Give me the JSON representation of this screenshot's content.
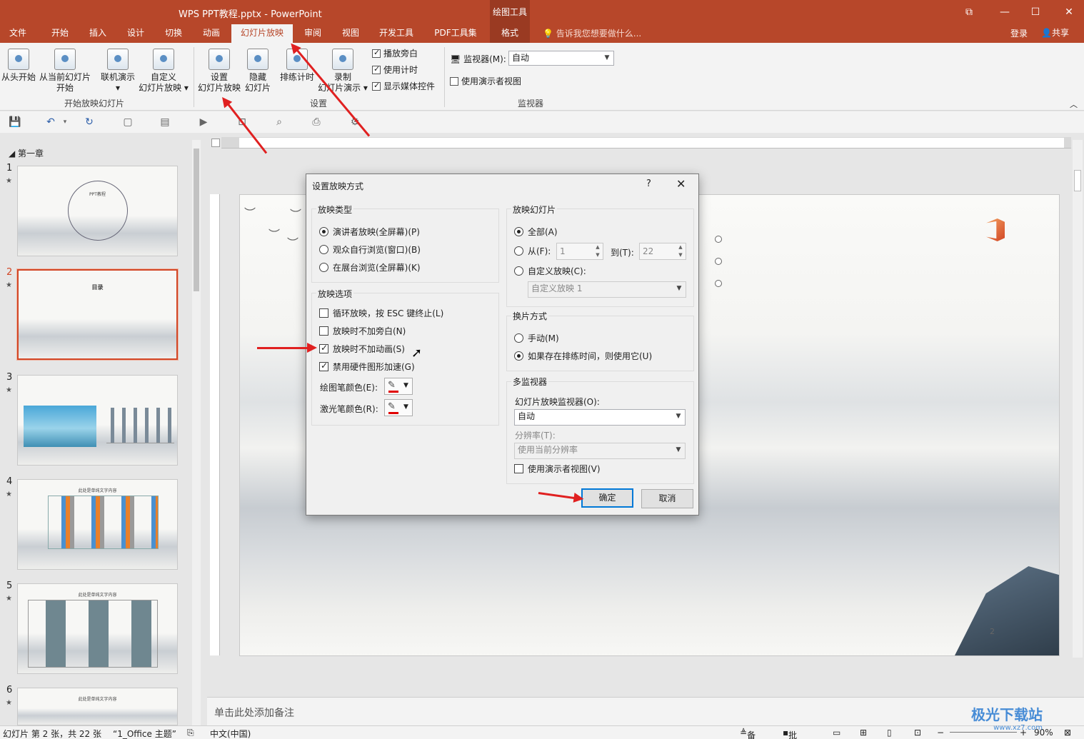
{
  "titlebar": {
    "title": "WPS PPT教程.pptx - PowerPoint",
    "context_label": "绘图工具",
    "minimize": "—",
    "maximize": "☐",
    "close": "✕",
    "restore": "⧉"
  },
  "tabs": {
    "items": [
      {
        "label": "文件"
      },
      {
        "label": "开始"
      },
      {
        "label": "插入"
      },
      {
        "label": "设计"
      },
      {
        "label": "切换"
      },
      {
        "label": "动画"
      },
      {
        "label": "幻灯片放映",
        "active": true
      },
      {
        "label": "审阅"
      },
      {
        "label": "视图"
      },
      {
        "label": "开发工具"
      },
      {
        "label": "PDF工具集"
      },
      {
        "label": "格式"
      }
    ],
    "tell_me": "告诉我您想要做什么...",
    "login": "登录",
    "share": "共享"
  },
  "ribbon": {
    "start_group": {
      "label": "开始放映幻灯片",
      "from_start": "从头开始",
      "from_current_1": "从当前幻灯片",
      "from_current_2": "开始",
      "online_1": "联机演示",
      "online_2": "▾",
      "custom_1": "自定义",
      "custom_2": "幻灯片放映 ▾"
    },
    "setup_group": {
      "label": "设置",
      "setup_1": "设置",
      "setup_2": "幻灯片放映",
      "hide_1": "隐藏",
      "hide_2": "幻灯片",
      "rehearse": "排练计时",
      "record_1": "录制",
      "record_2": "幻灯片演示 ▾",
      "narration": "播放旁白",
      "use_timings": "使用计时",
      "show_media": "显示媒体控件"
    },
    "monitor_group": {
      "label": "监视器",
      "monitor_label": "监视器(M):",
      "monitor_value": "自动",
      "presenter_view": "使用演示者视图"
    }
  },
  "left_pane": {
    "section": "第一章",
    "slides": [
      {
        "num": "1",
        "title": "PPT教程"
      },
      {
        "num": "2",
        "title": "目录"
      },
      {
        "num": "3",
        "title": ""
      },
      {
        "num": "4",
        "title": "此处是单纯文字内容"
      },
      {
        "num": "5",
        "title": "此处是单纯文字内容"
      },
      {
        "num": "6",
        "title": "此处是单纯文字内容"
      }
    ]
  },
  "slide": {
    "page_number": "2"
  },
  "notes": {
    "placeholder": "单击此处添加备注"
  },
  "statusbar": {
    "slide_info": "幻灯片 第 2 张，共 22 张",
    "theme": "“1_Office 主题”",
    "language": "中文(中国)",
    "notes": "备注",
    "comments": "批注",
    "zoom": "90%"
  },
  "dialog": {
    "title": "设置放映方式",
    "help": "?",
    "close": "✕",
    "show_type": {
      "label": "放映类型",
      "options": [
        "演讲者放映(全屏幕)(P)",
        "观众自行浏览(窗口)(B)",
        "在展台浏览(全屏幕)(K)"
      ],
      "selected": 0
    },
    "show_options": {
      "label": "放映选项",
      "loop": "循环放映，按 ESC 键终止(L)",
      "no_narration": "放映时不加旁白(N)",
      "no_animation": "放映时不加动画(S)",
      "disable_hw": "禁用硬件图形加速(G)",
      "pen_color": "绘图笔颜色(E):",
      "laser_color": "激光笔颜色(R):"
    },
    "show_slides": {
      "label": "放映幻灯片",
      "all": "全部(A)",
      "from": "从(F):",
      "from_value": "1",
      "to": "到(T):",
      "to_value": "22",
      "custom": "自定义放映(C):",
      "custom_value": "自定义放映 1"
    },
    "advance": {
      "label": "换片方式",
      "manual": "手动(M)",
      "timings": "如果存在排练时间，则使用它(U)"
    },
    "multi_monitor": {
      "label": "多监视器",
      "monitor_label": "幻灯片放映监视器(O):",
      "monitor_value": "自动",
      "resolution_label": "分辨率(T):",
      "resolution_value": "使用当前分辨率",
      "presenter_view": "使用演示者视图(V)"
    },
    "ok": "确定",
    "cancel": "取消"
  },
  "watermark": {
    "text": "极光下载站",
    "url": "www.xz7.com"
  },
  "accent": "#b7472a"
}
